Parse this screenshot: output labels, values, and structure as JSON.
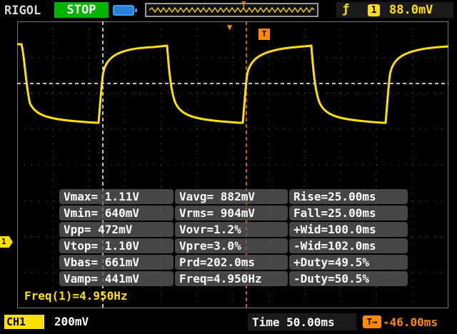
{
  "header": {
    "brand": "RIGOL",
    "run_status": "STOP",
    "trigger_slope_icon": "rising-edge-icon",
    "trigger_source": "1",
    "trigger_level": "88.0mV",
    "trigger_pos_label": "T"
  },
  "screen": {
    "trigger_marker_label": "T",
    "channel_marker_label": "1"
  },
  "measurements": [
    [
      "Vmax= 1.11V",
      "Vavg= 882mV",
      "Rise=25.00ms"
    ],
    [
      "Vmin= 640mV",
      "Vrms= 904mV",
      "Fall=25.00ms"
    ],
    [
      "Vpp= 472mV",
      "Vovr=1.2%",
      "+Wid=100.0ms"
    ],
    [
      "Vtop= 1.10V",
      "Vpre=3.0%",
      "-Wid=102.0ms"
    ],
    [
      "Vbas= 661mV",
      "Prd=202.0ms",
      "+Duty=49.5%"
    ],
    [
      "Vamp= 441mV",
      "Freq=4.950Hz",
      "-Duty=50.5%"
    ]
  ],
  "frequency_counter": "Freq(1)=4.950Hz",
  "footer": {
    "channel_badge": "CH1",
    "channel_scale": "200mV",
    "timebase": "Time 50.00ms",
    "trigger_offset": "-46.00ms"
  },
  "colors": {
    "channel1": "#ffe000",
    "trigger": "#ff8a00",
    "run_stop": "#00b400"
  }
}
